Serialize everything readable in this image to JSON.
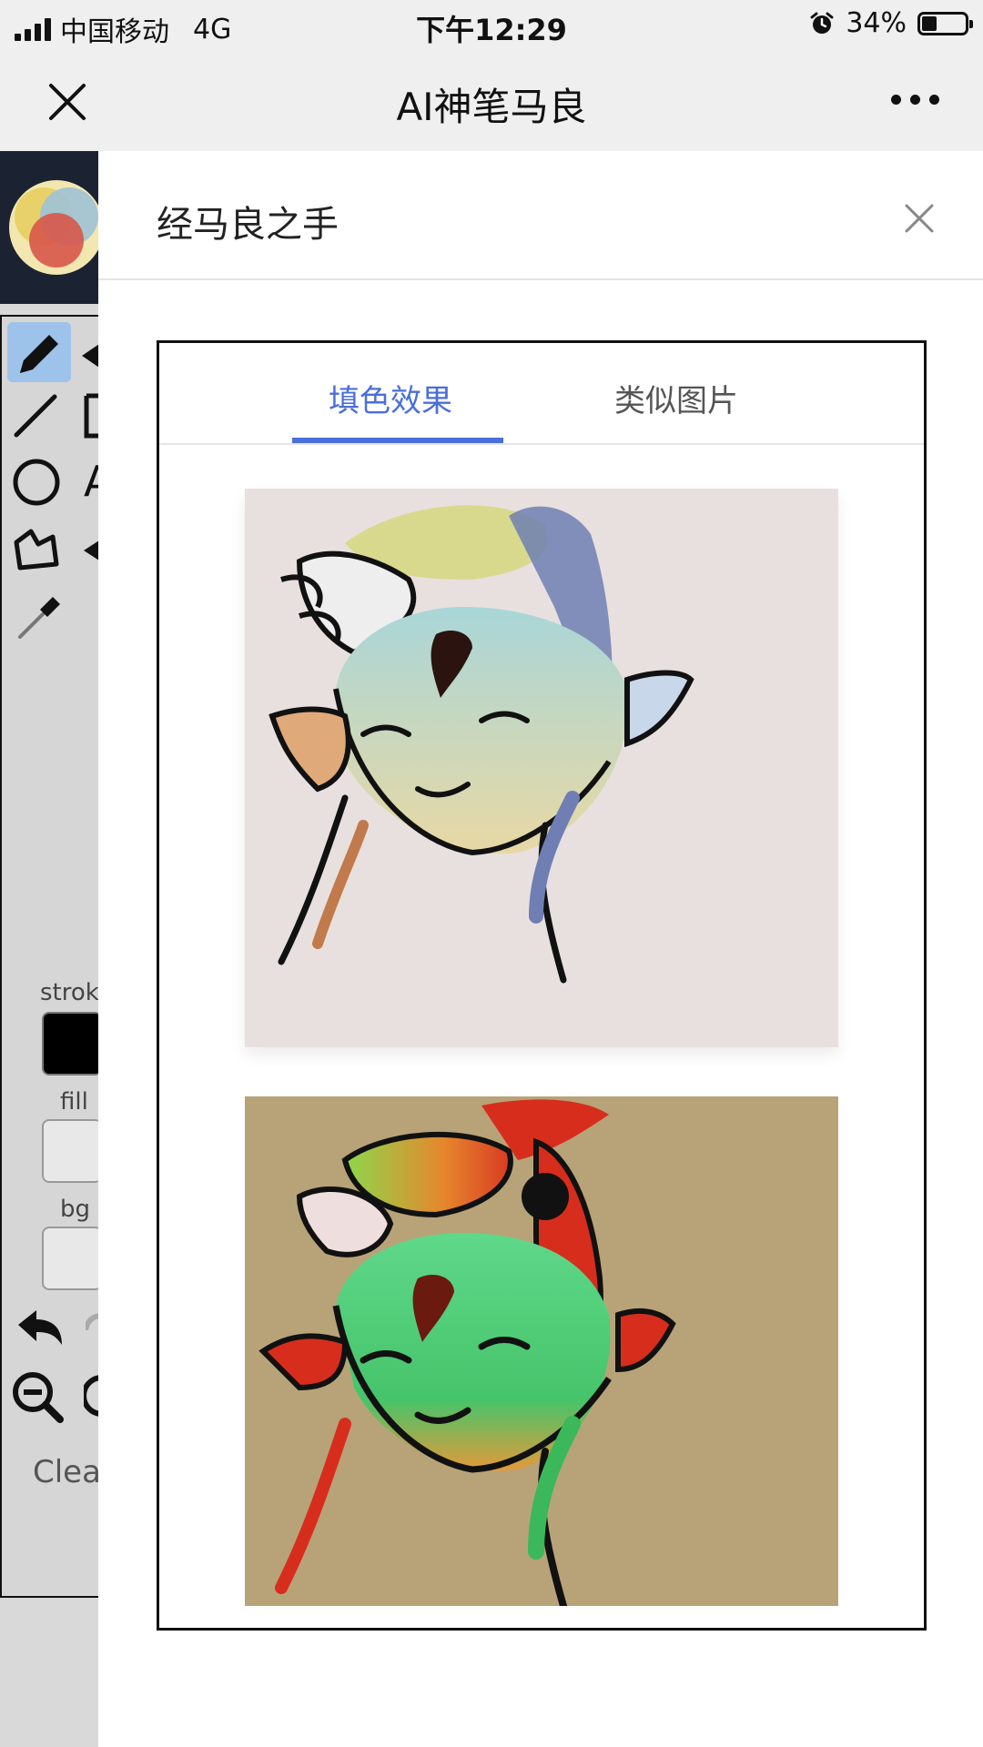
{
  "status_bar": {
    "carrier": "中国移动",
    "network": "4G",
    "time": "下午12:29",
    "battery_percent": "34%",
    "battery_level": 0.34,
    "icons": [
      "signal-icon",
      "alarm-icon",
      "battery-icon"
    ]
  },
  "nav": {
    "title": "AI神笔马良",
    "close_icon": "close-icon",
    "more_icon": "more-icon"
  },
  "background_app": {
    "labels": {
      "stroke": "stroke",
      "fill": "fill",
      "bg": "bg",
      "clear": "Clea"
    },
    "colors": {
      "stroke_swatch": "#000000"
    }
  },
  "sheet": {
    "title": "经马良之手",
    "tabs": [
      {
        "label": "填色效果",
        "active": true
      },
      {
        "label": "类似图片",
        "active": false
      }
    ],
    "images": [
      "colorized-result-image-1",
      "colorized-result-image-2"
    ]
  },
  "colors": {
    "accent": "#4a6fd8",
    "nav_bg": "#efefef"
  }
}
